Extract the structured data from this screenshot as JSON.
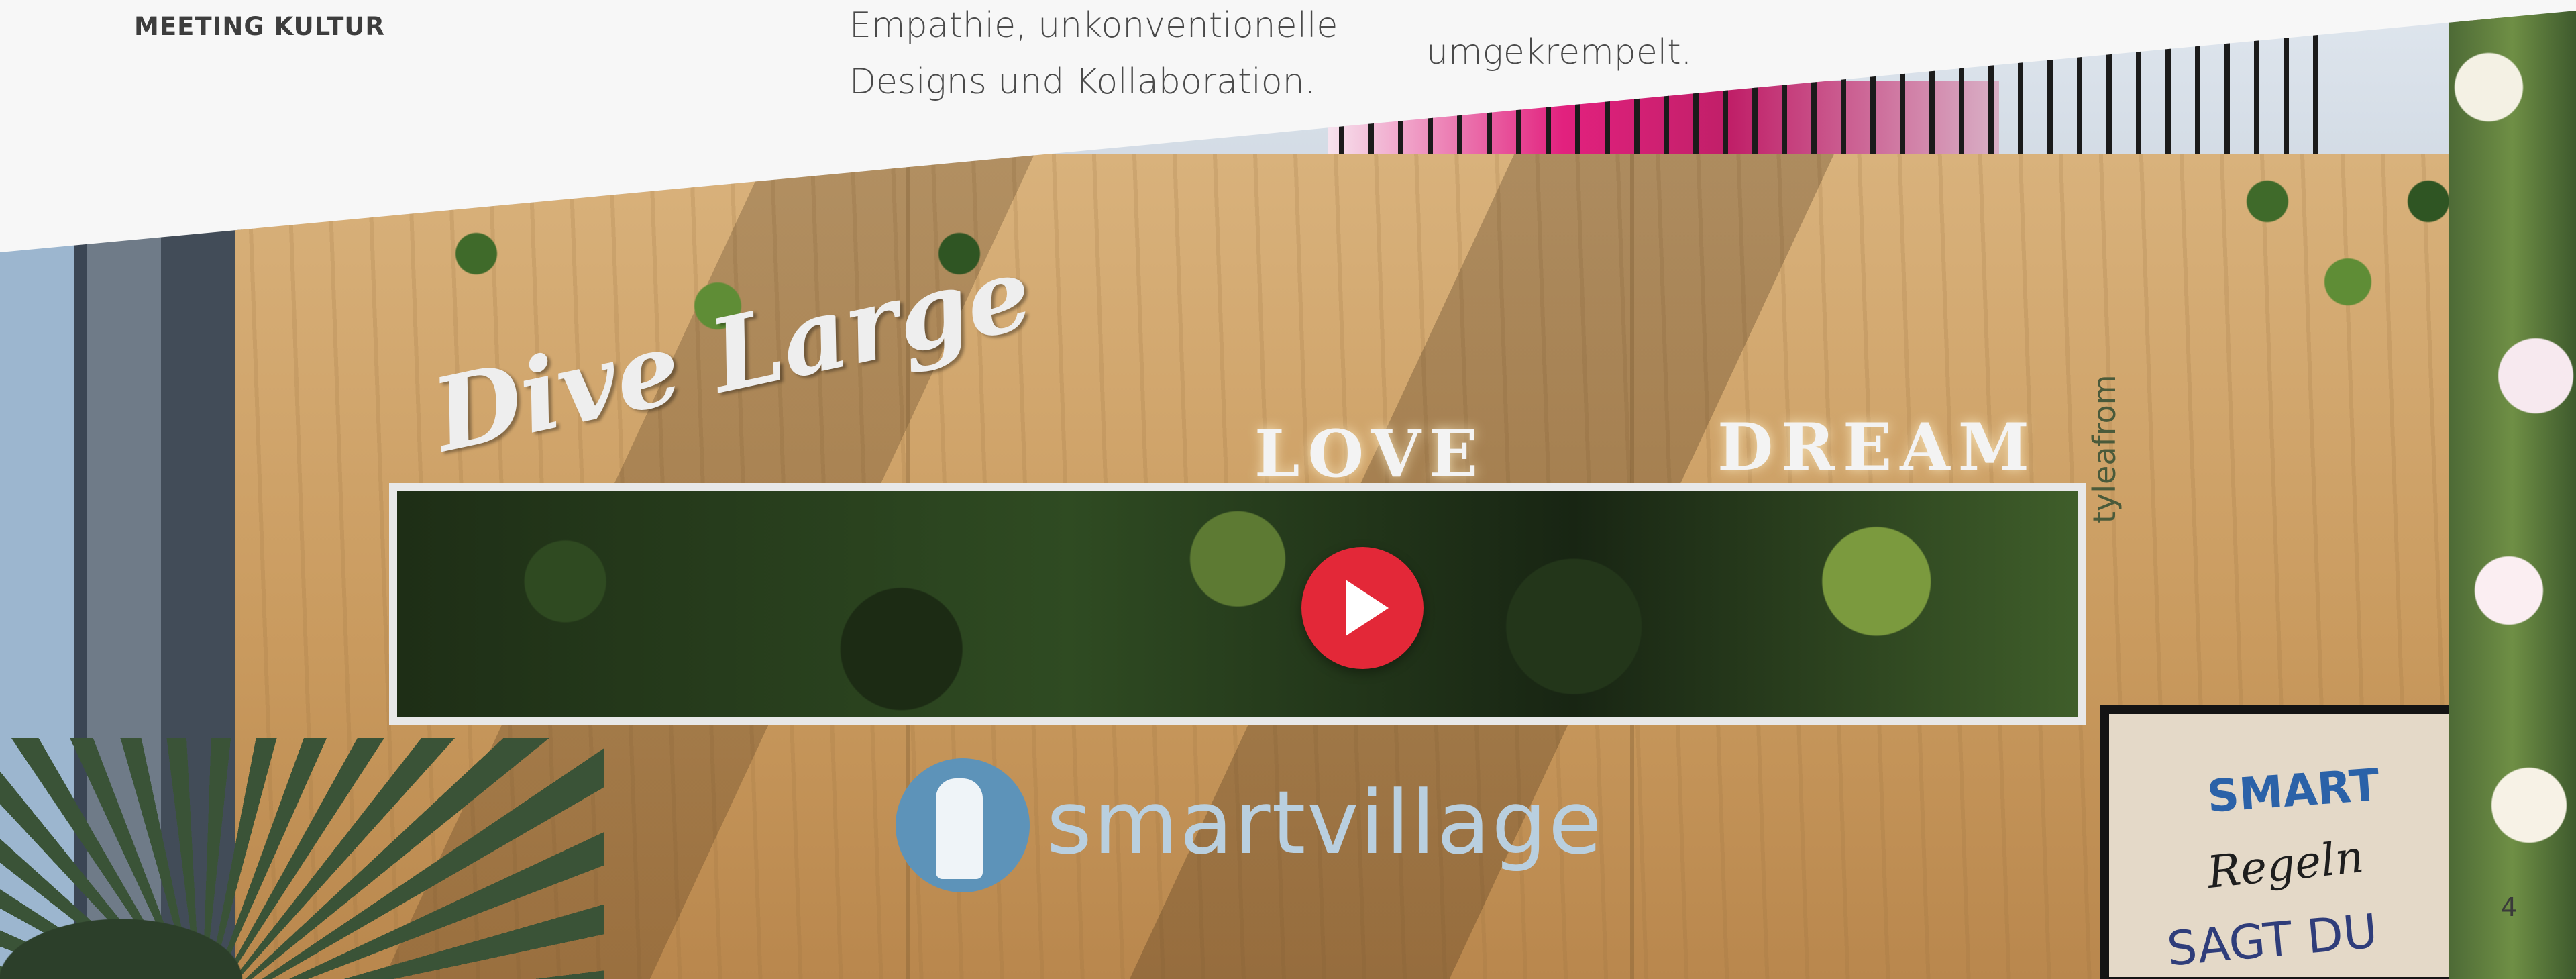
{
  "section": {
    "label": "MEETING KULTUR"
  },
  "intro": {
    "col_a_lines": [
      "Empathie, unkonventionelle",
      "Designs und Kollaboration."
    ],
    "col_b_lines": [
      "umgekrempelt."
    ]
  },
  "video": {
    "signs": {
      "script": "Dive Large",
      "love": "LOVE",
      "dream": "DREAM"
    },
    "logo_text": "smartvillage",
    "vertical_text": "tyleafrom",
    "board": {
      "title": "SMART",
      "line2": "Regeln",
      "line3": "SAGT DU"
    },
    "play_button_icon": "play-icon",
    "accent_color": "#e32838"
  },
  "page_number": "4"
}
